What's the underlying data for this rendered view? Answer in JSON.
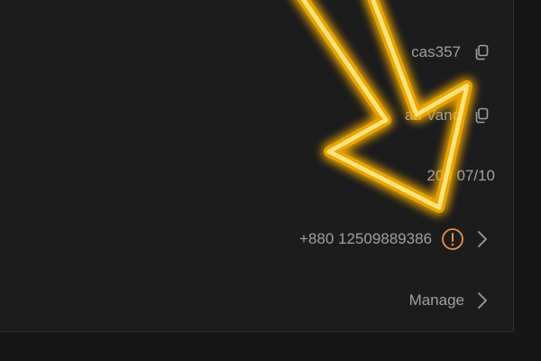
{
  "details": {
    "username": "cas357",
    "name": "an Vand",
    "date": "200  07/10",
    "phone": "+880 12509889386",
    "manage_label": "Manage"
  },
  "icons": {
    "copy": "copy-icon",
    "warning": "exclamation-circle-icon",
    "chevron": "chevron-right-icon"
  },
  "colors": {
    "background": "#161616",
    "panel": "#1c1c1c",
    "text": "#9aa0a6",
    "warning": "#e8914a",
    "annotation_arrow": "#ffd400"
  }
}
